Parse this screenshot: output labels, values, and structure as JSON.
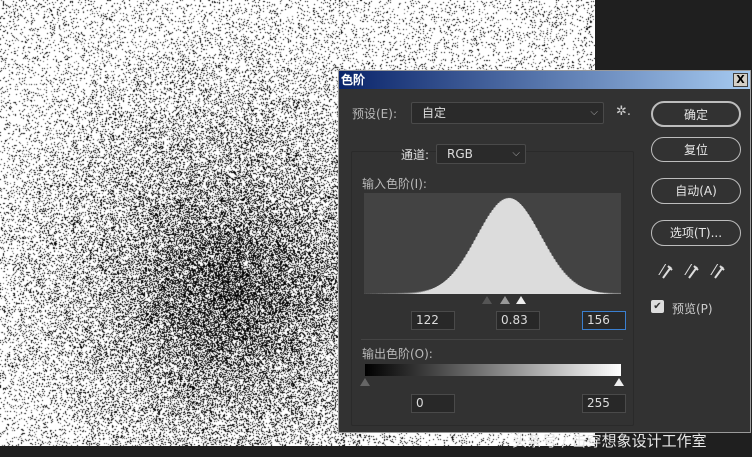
{
  "dialog": {
    "title": "色阶",
    "close_label": "X"
  },
  "preset": {
    "label": "预设(E):",
    "value": "自定"
  },
  "channel": {
    "label": "通道:",
    "value": "RGB"
  },
  "input_levels": {
    "label": "输入色阶(I):",
    "black": "122",
    "gamma": "0.83",
    "white": "156"
  },
  "output_levels": {
    "label": "输出色阶(O):",
    "black": "0",
    "white": "255"
  },
  "buttons": {
    "ok": "确定",
    "reset": "复位",
    "auto": "自动(A)",
    "options": "选项(T)..."
  },
  "preview": {
    "label": "预览(P)",
    "checked": true
  },
  "watermark": "头条号 / 击穿想象设计工作室"
}
